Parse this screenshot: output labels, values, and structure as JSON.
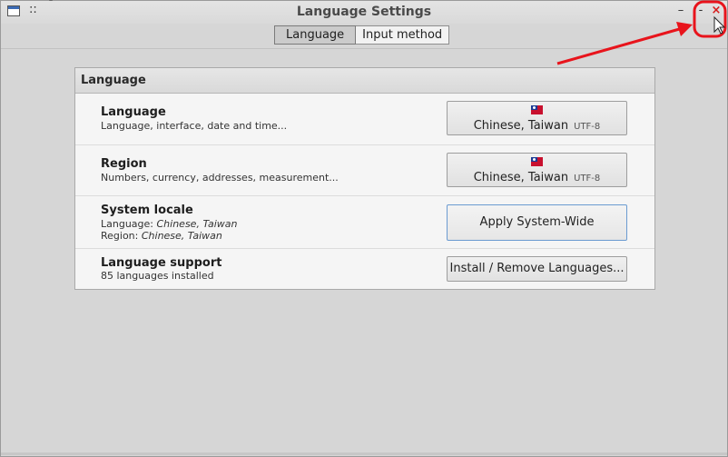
{
  "window": {
    "title": "Language Settings",
    "menu_glyph": "::",
    "pin_glyph": "¯",
    "minimize_glyph": "–",
    "maximize_glyph": "-",
    "close_glyph": "×"
  },
  "tabs": [
    {
      "label": "Language",
      "active": true
    },
    {
      "label": "Input method",
      "active": false
    }
  ],
  "panel": {
    "header": "Language",
    "rows": {
      "language": {
        "title": "Language",
        "subtitle": "Language, interface, date and time...",
        "button_label": "Chinese, Taiwan",
        "button_encoding": "UTF-8",
        "flag_icon": "taiwan-flag-icon"
      },
      "region": {
        "title": "Region",
        "subtitle": "Numbers, currency, addresses, measurement...",
        "button_label": "Chinese, Taiwan",
        "button_encoding": "UTF-8",
        "flag_icon": "taiwan-flag-icon"
      },
      "system_locale": {
        "title": "System locale",
        "language_prefix": "Language: ",
        "language_value": "Chinese, Taiwan",
        "region_prefix": "Region: ",
        "region_value": "Chinese, Taiwan",
        "button_label": "Apply System-Wide"
      },
      "language_support": {
        "title": "Language support",
        "subtitle": "85 languages installed",
        "button_label": "Install / Remove Languages..."
      }
    }
  },
  "annotation": {
    "color": "#e8141c"
  }
}
